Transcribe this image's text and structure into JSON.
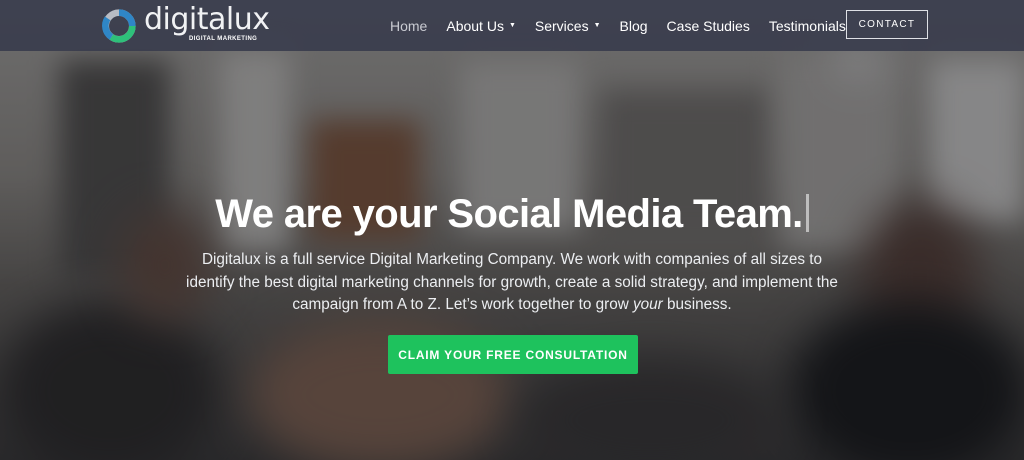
{
  "brand": {
    "name": "digitalux",
    "tagline": "DIGITAL MARKETING",
    "colors": {
      "ring_blue": "#2f86c6",
      "ring_green": "#2ec07a",
      "ring_grey": "#b8bcc4"
    }
  },
  "nav": {
    "items": [
      {
        "label": "Home",
        "active": true,
        "dropdown": false
      },
      {
        "label": "About Us",
        "active": false,
        "dropdown": true
      },
      {
        "label": "Services",
        "active": false,
        "dropdown": true
      },
      {
        "label": "Blog",
        "active": false,
        "dropdown": false
      },
      {
        "label": "Case Studies",
        "active": false,
        "dropdown": false
      },
      {
        "label": "Testimonials",
        "active": false,
        "dropdown": false
      }
    ],
    "caret_icon": "caret-down-icon",
    "contact_label": "CONTACT"
  },
  "hero": {
    "title": "We are your Social Media Team.",
    "description_before": "Digitalux is a full service Digital Marketing Company. We work with companies of all sizes to identify the best digital marketing channels for growth, create a solid strategy, and implement the campaign from A to Z. Let’s work together to grow ",
    "description_emphasis": "your",
    "description_after": " business.",
    "cta_label": "CLAIM YOUR FREE CONSULTATION",
    "cta_color": "#1ec25d"
  }
}
